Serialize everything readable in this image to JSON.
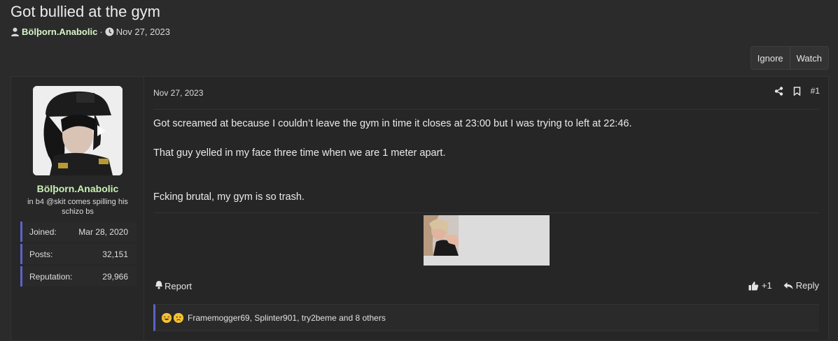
{
  "thread": {
    "title": "Got bullied at the gym",
    "author": "Bölþorn.Anabolic",
    "separator": "·",
    "date": "Nov 27, 2023"
  },
  "actions": {
    "ignore": "Ignore",
    "watch": "Watch"
  },
  "user": {
    "name": "Bölþorn.Anabolic",
    "title": "in b4 @skit comes spilling his schizo bs",
    "stats": [
      {
        "label": "Joined:",
        "value": "Mar 28, 2020"
      },
      {
        "label": "Posts:",
        "value": "32,151"
      },
      {
        "label": "Reputation:",
        "value": "29,966"
      }
    ]
  },
  "post": {
    "date": "Nov 27, 2023",
    "number": "#1",
    "lines": [
      "Got screamed at because I couldn’t leave the gym in time it closes at 23:00 but I was trying to left at 22:46.",
      "That guy yelled in my face three time when we are 1 meter apart.",
      "Fcking brutal, my gym is so trash."
    ],
    "report": "Report",
    "like": "+1",
    "reply": "Reply",
    "reactions": "Framemogger69, Splinter901, try2beme and 8 others"
  },
  "colors": {
    "background": "#2b2b2b",
    "username": "#c8f2b4",
    "accent_border": "#5b63c9"
  },
  "icons": [
    "user-icon",
    "clock-icon",
    "share-icon",
    "bookmark-icon",
    "bell-icon",
    "thumbs-up-icon",
    "reply-icon",
    "laughing-emoji-icon",
    "sad-emoji-icon"
  ]
}
